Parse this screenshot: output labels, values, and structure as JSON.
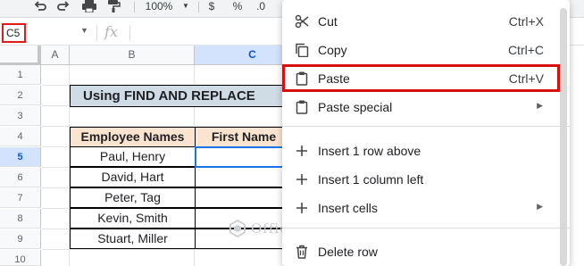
{
  "toolbar": {
    "zoom": "100%",
    "currency": "$",
    "percent": "%",
    "decimal": ".0"
  },
  "formula_bar": {
    "name_box": "C5",
    "fx_label": "fx"
  },
  "columns": [
    "A",
    "B",
    "C"
  ],
  "rows": [
    "1",
    "2",
    "3",
    "4",
    "5",
    "6",
    "7",
    "8",
    "9",
    "10"
  ],
  "sheet": {
    "title": "Using FIND AND REPLACE",
    "table_headers": [
      "Employee Names",
      "First Name"
    ],
    "employees": [
      "Paul, Henry",
      "David, Hart",
      "Peter, Tag",
      "Kevin, Smith",
      "Stuart, Miller"
    ]
  },
  "watermark": "OfficeWheel",
  "context_menu": {
    "items": [
      {
        "label": "Cut",
        "shortcut": "Ctrl+X",
        "icon": "scissors-icon"
      },
      {
        "label": "Copy",
        "shortcut": "Ctrl+C",
        "icon": "copy-icon"
      },
      {
        "label": "Paste",
        "shortcut": "Ctrl+V",
        "icon": "clipboard-icon",
        "highlighted": true
      },
      {
        "label": "Paste special",
        "icon": "clipboard-icon",
        "submenu": true
      },
      {
        "label": "Insert 1 row above",
        "icon": "plus-icon"
      },
      {
        "label": "Insert 1 column left",
        "icon": "plus-icon"
      },
      {
        "label": "Insert cells",
        "icon": "plus-icon",
        "submenu": true
      },
      {
        "label": "Delete row",
        "icon": "trash-icon"
      }
    ],
    "highlight_color": "#d90f0f"
  },
  "colors": {
    "title_fill": "#cfdce6",
    "header_fill": "#fbe4cf",
    "selection": "#1a73e8",
    "name_box_highlight": "#e01b1b"
  }
}
